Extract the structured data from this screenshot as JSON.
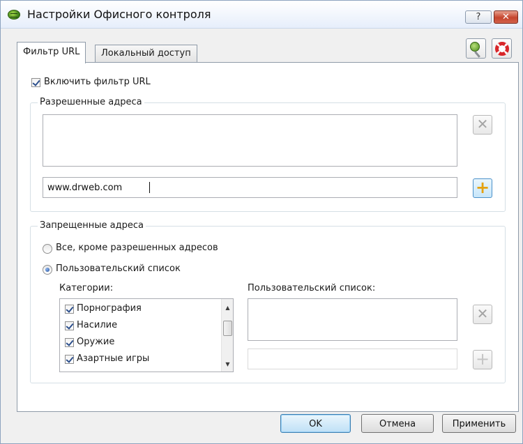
{
  "window": {
    "title": "Настройки Офисного контроля",
    "help_label": "?",
    "close_label": "✕"
  },
  "tabs": [
    {
      "label": "Фильтр URL",
      "active": true
    },
    {
      "label": "Локальный доступ",
      "active": false
    }
  ],
  "toolbar": {
    "key_icon": "key-icon",
    "help_icon": "lifebuoy-icon"
  },
  "url_filter": {
    "enable_label": "Включить фильтр URL",
    "enabled": true,
    "allowed": {
      "legend": "Разрешенные адреса",
      "items": [],
      "input_value": "www.drweb.com",
      "remove_label": "✕",
      "add_label": "+"
    },
    "blocked": {
      "legend": "Запрещенные адреса",
      "option_all_label": "Все, кроме разрешенных адресов",
      "option_custom_label": "Пользовательский список",
      "selected_option": "custom",
      "categories_label": "Категории:",
      "categories": [
        {
          "label": "Порнография",
          "checked": true
        },
        {
          "label": "Насилие",
          "checked": true
        },
        {
          "label": "Оружие",
          "checked": true
        },
        {
          "label": "Азартные игры",
          "checked": true
        }
      ],
      "custom_list_label": "Пользовательский список:",
      "custom_items": [],
      "custom_input_value": "",
      "remove_label": "✕",
      "add_label": "+"
    }
  },
  "buttons": {
    "ok": "OK",
    "cancel": "Отмена",
    "apply": "Применить"
  }
}
